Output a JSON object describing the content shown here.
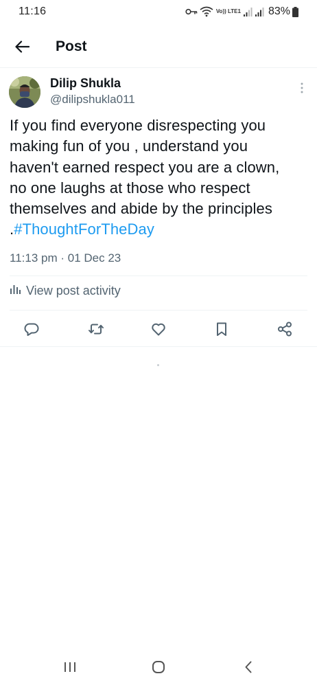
{
  "status_bar": {
    "time": "11:16",
    "volte_label": "Vo)) LTE1",
    "battery": "83%"
  },
  "header": {
    "title": "Post"
  },
  "post": {
    "author_name": "Dilip Shukla",
    "author_handle": "@dilipshukla011",
    "text": "If you find everyone disrespecting you making fun of you , understand you haven't earned respect you are a clown,  no one laughs at those who respect themselves and abide by the principles .",
    "hashtag": "#ThoughtForTheDay",
    "time": "11:13 pm",
    "separator": " · ",
    "date": "01 Dec 23",
    "activity_label": "View post activity"
  },
  "actions": [
    "reply-icon",
    "repost-icon",
    "like-icon",
    "bookmark-icon",
    "share-icon"
  ],
  "colors": {
    "text": "#0f1419",
    "secondary": "#536471",
    "link": "#1d9bf0",
    "divider": "#eff3f4"
  }
}
